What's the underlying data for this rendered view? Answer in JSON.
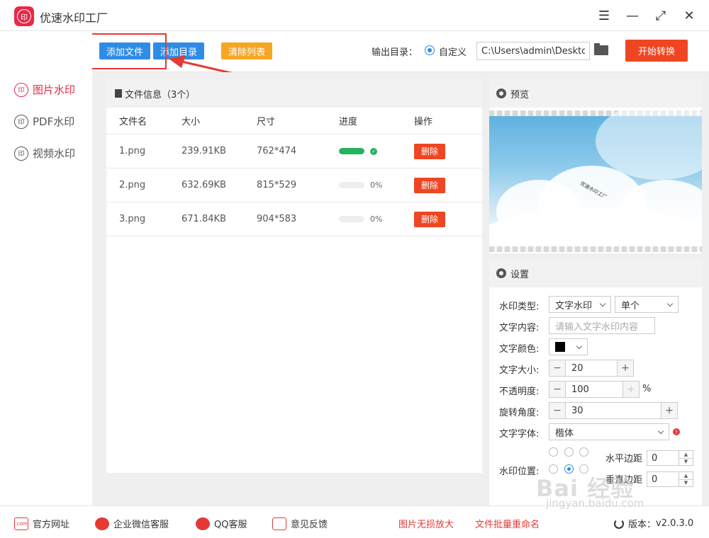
{
  "app": {
    "title": "优速水印工厂",
    "logo_text": "印"
  },
  "window_controls": {
    "menu": "☰",
    "minimize": "—",
    "maximize": "⤢",
    "close": "✕"
  },
  "toolbar": {
    "add_file": "添加文件",
    "add_dir": "添加目录",
    "clear_list": "清除列表",
    "output_label": "输出目录：",
    "output_option": "自定义",
    "output_path": "C:\\Users\\admin\\Deskto",
    "start": "开始转换"
  },
  "sidebar": {
    "items": [
      {
        "label": "图片水印",
        "icon": "印"
      },
      {
        "label": "PDF水印",
        "icon": "印"
      },
      {
        "label": "视频水印",
        "icon": "印"
      }
    ]
  },
  "file_panel": {
    "title": "文件信息（3个）",
    "columns": [
      "文件名",
      "大小",
      "尺寸",
      "进度",
      "操作"
    ],
    "rows": [
      {
        "name": "1.png",
        "size": "239.91KB",
        "dims": "762*474",
        "progress": 100,
        "progress_text": "",
        "action": "删除"
      },
      {
        "name": "2.png",
        "size": "632.69KB",
        "dims": "815*529",
        "progress": 0,
        "progress_text": "0%",
        "action": "删除"
      },
      {
        "name": "3.png",
        "size": "671.84KB",
        "dims": "904*583",
        "progress": 0,
        "progress_text": "0%",
        "action": "删除"
      }
    ]
  },
  "preview": {
    "title": "预览",
    "watermark": "优速水印工厂"
  },
  "settings": {
    "title": "设置",
    "type_label": "水印类型:",
    "type_value": "文字水印",
    "mode_value": "单个",
    "content_label": "文字内容:",
    "content_placeholder": "请输入文字水印内容",
    "color_label": "文字颜色:",
    "color_value": "#000000",
    "size_label": "文字大小:",
    "size_value": "20",
    "opacity_label": "不透明度:",
    "opacity_value": "100",
    "opacity_unit": "%",
    "rotate_label": "旋转角度:",
    "rotate_value": "30",
    "font_label": "文字字体:",
    "font_value": "楷体",
    "position_label": "水印位置:",
    "h_margin_label": "水平边距",
    "h_margin_value": "0",
    "v_margin_label": "垂直边距",
    "v_margin_value": "0"
  },
  "footer": {
    "website": "官方网址",
    "website_icon": ".com",
    "wechat": "企业微信客服",
    "qq": "QQ客服",
    "feedback": "意见反馈",
    "link1": "图片无损放大",
    "link2": "文件批量重命名",
    "version_label": "版本：",
    "version": "v2.0.3.0"
  },
  "overlay_watermark": {
    "brand": "Bai 经验",
    "url": "jingyan.baidu.com"
  },
  "colors": {
    "accent_red": "#e8294a",
    "blue": "#2f8ce5",
    "orange": "#f5a623",
    "start_red": "#ee4623",
    "progress_green": "#22b35e"
  }
}
